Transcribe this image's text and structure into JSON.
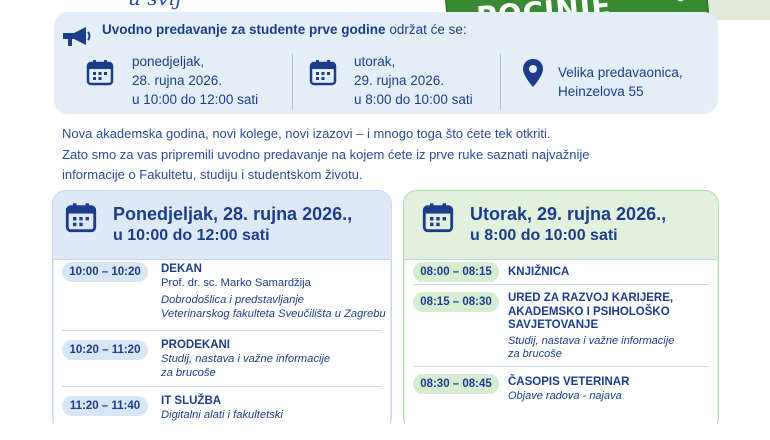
{
  "header": {
    "script_fragment": "u svij",
    "banner_text": "POČINJE OVDJE"
  },
  "info": {
    "title_bold": "Uvodno predavanje za studente prve godine",
    "title_rest": "održat će se:",
    "session1": {
      "day": "ponedjeljak,",
      "date": "28. rujna 2026.",
      "time": "u 10:00 do 12:00 sati"
    },
    "session2": {
      "day": "utorak,",
      "date": "29. rujna 2026.",
      "time": "u 8:00 do 10:00 sati"
    },
    "location": {
      "line1": "Velika predavaonica,",
      "line2": "Heinzelova 55"
    }
  },
  "intro": {
    "line1": "Nova akademska godina, novi kolege, novi izazovi – i mnogo toga što ćete tek otkriti.",
    "line2": "Zato smo za vas pripremili uvodno predavanje na kojem ćete iz prve ruke saznati najvažnije",
    "line3": "informacije o Fakultetu, studiju i studentskom životu."
  },
  "monday": {
    "heading": "Ponedjeljak, 28. rujna 2026.,",
    "subheading": "u 10:00 do 12:00 sati",
    "items": [
      {
        "time": "10:00 – 10:20",
        "title": "DEKAN",
        "line1": "Prof. dr. sc. Marko Samardžija",
        "line2": "Dobrodošlica i predstavljanje",
        "line3": "Veterinarskog fakulteta Sveučilišta u Zagrebu"
      },
      {
        "time": "10:20 – 11:20",
        "title": "PRODEKANI",
        "line1": "Studij, nastava i važne informacije",
        "line2": "za brucoše"
      },
      {
        "time": "11:20 – 11:40",
        "title": "IT SLUŽBA",
        "line1": "Digitalni alati i fakultetski"
      }
    ]
  },
  "tuesday": {
    "heading": "Utorak, 29. rujna 2026.,",
    "subheading": "u 8:00 do 10:00 sati",
    "items": [
      {
        "time": "08:00 – 08:15",
        "title": "KNJIŽNICA"
      },
      {
        "time": "08:15 – 08:30",
        "title1": "URED ZA RAZVOJ KARIJERE,",
        "title2": "AKADEMSKO I PSIHOLOŠKO",
        "title3": "SAVJETOVANJE",
        "line1": "Studij, nastava i važne informacije",
        "line2": "za brucoše"
      },
      {
        "time": "08:30 – 08:45",
        "title": "ČASOPIS VETERINAR",
        "line1": "Objave radova - najava"
      }
    ]
  },
  "colors": {
    "navy": "#1d3d8c",
    "blue_panel": "#e3eef9",
    "green_panel": "#e1f1dd",
    "banner_green": "#3a8a34"
  },
  "icons": [
    "megaphone-icon",
    "calendar-icon",
    "location-pin-icon",
    "paw-icon"
  ]
}
